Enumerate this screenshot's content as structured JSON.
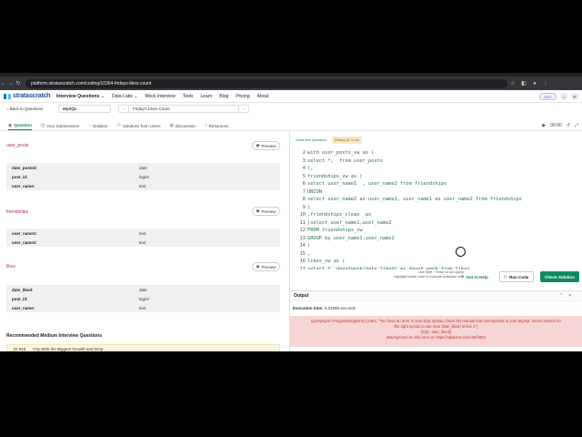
{
  "browser": {
    "url": "platform.stratascratch.com/coding/10364-fridays-likes-count"
  },
  "header": {
    "logo_text": "stratascratch",
    "menu": [
      "Interview Questions ⌄",
      "Data Labs ⌄",
      "Mock Interview",
      "Tools",
      "Learn",
      "Blog",
      "Pricing",
      "About"
    ],
    "streak": "3997",
    "avatar": "P"
  },
  "toolbar": {
    "back_label": "Back to Questions",
    "dialect": "MySQL",
    "question_title": "Friday's Likes Count"
  },
  "tabs": [
    "Question",
    "Your Submissions",
    "Solution",
    "Solutions from Users",
    "Discussion",
    "Resources"
  ],
  "timer": "00:00",
  "tables": [
    {
      "name": "user_posts",
      "preview": "Preview",
      "columns": [
        {
          "col": "date_posted:",
          "type": "date"
        },
        {
          "col": "post_id:",
          "type": "bigint"
        },
        {
          "col": "user_name:",
          "type": "text"
        }
      ]
    },
    {
      "name": "friendships",
      "preview": "Preview",
      "columns": [
        {
          "col": "user_name1:",
          "type": "text"
        },
        {
          "col": "user_name2:",
          "type": "text"
        }
      ]
    },
    {
      "name": "likes",
      "preview": "Preview",
      "columns": [
        {
          "col": "date_liked:",
          "type": "date"
        },
        {
          "col": "post_id:",
          "type": "bigint"
        },
        {
          "col": "user_name:",
          "type": "text"
        }
      ]
    }
  ],
  "recommended": {
    "title": "Recommended Medium Interview Questions",
    "item_id": "ID 515",
    "item_title": "City With the Biggest Growth and Drop"
  },
  "editor": {
    "tabs": [
      "Solve the Question",
      "Debug AI Code"
    ],
    "lines": [
      {
        "n": "2",
        "code": "with user_posts_vw as ("
      },
      {
        "n": "3",
        "code": "select *,  from user_posts"
      },
      {
        "n": "4",
        "code": "),"
      },
      {
        "n": "5",
        "code": "friendships_vw as ("
      },
      {
        "n": "6",
        "code": "select user_name1  , user_name2 from friendships"
      },
      {
        "n": "7",
        "code": "UNION"
      },
      {
        "n": "8",
        "code": "select user_name2 as user_name1, user_name1 as user_name2 from friendships"
      },
      {
        "n": "9",
        "code": ")"
      },
      {
        "n": "10",
        "code": ",friendships_clean  as"
      },
      {
        "n": "11",
        "code": "(select user_name1,user_name2"
      },
      {
        "n": "12",
        "code": "FROM friendships_vw"
      },
      {
        "n": "13",
        "code": "GROUP by user_name1,user_name2"
      },
      {
        "n": "14",
        "code": ")"
      },
      {
        "n": "15",
        "code": ","
      },
      {
        "n": "16",
        "code": "likes_vw as ("
      },
      {
        "n": "17",
        "code": "select *, dayofweek(date_liked) as dayof_week from likes"
      },
      {
        "n": "18",
        "code": ")"
      },
      {
        "n": "19",
        "code": "select * from likes_vw"
      }
    ],
    "hint_line1": "Use Shift + Enter to run query",
    "hint_line2": "Highlight some code to execute selection only",
    "ai_help": "Get AI Help",
    "run_code": "Run Code",
    "check_solution": "Check Solution"
  },
  "output": {
    "title": "Output",
    "exec_label": "Execution time:",
    "exec_value": "0.01098 seconds",
    "error_line1": "(pymysql.err.ProgrammingError) (1064, \"You have an error in your SQL syntax; check the manual that corresponds to your MySQL server version for",
    "error_line2": "the right syntax to use near 'date_liked) at line 1\")",
    "error_line3": "[SQL: date_liked)]",
    "error_line4": "(Background on this error at: https://sqlalche.me/e/20/f405)"
  }
}
